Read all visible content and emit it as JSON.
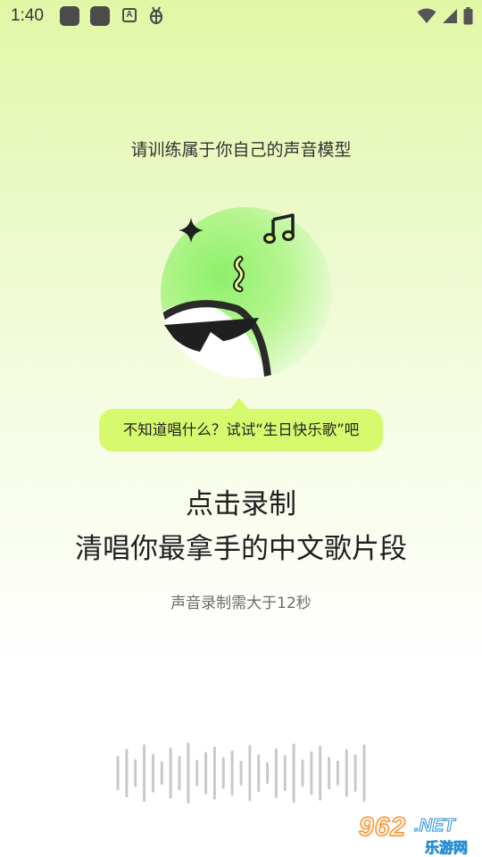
{
  "status_bar": {
    "time": "1:40",
    "icons": [
      "notification-square-icon",
      "notification-square-icon",
      "text-a-icon",
      "bug-icon",
      "wifi-icon",
      "signal-icon",
      "battery-icon"
    ]
  },
  "page": {
    "title": "请训练属于你自己的声音模型",
    "bubble_text": "不知道唱什么？试试“生日快乐歌”吧",
    "headline_line1": "点击录制",
    "headline_line2": "清唱你最拿手的中文歌片段",
    "hint": "声音录制需大于12秒"
  },
  "mascot": {
    "icons": [
      "sparkle-icon",
      "music-note-icon",
      "squiggle-note-icon",
      "sunglasses-icon"
    ]
  },
  "waveform": {
    "levels": [
      0.55,
      0.78,
      0.45,
      0.92,
      0.62,
      0.38,
      0.82,
      0.55,
      0.98,
      0.42,
      0.68,
      0.85,
      0.5,
      0.72,
      0.4,
      0.9,
      0.6,
      0.35,
      0.8,
      0.58,
      0.95,
      0.44,
      0.7,
      0.88,
      0.52,
      0.4,
      0.76,
      0.6,
      0.92
    ]
  },
  "watermark": {
    "brand": "962",
    "domain": ".NET",
    "site_name": "乐游网"
  },
  "colors": {
    "accent_lime": "#d7f96d",
    "mascot_green": "#a5f07c",
    "text_dark": "#1e1e1e",
    "text_muted": "#6c6c6c",
    "waveform_bar": "#c9c9c9"
  }
}
